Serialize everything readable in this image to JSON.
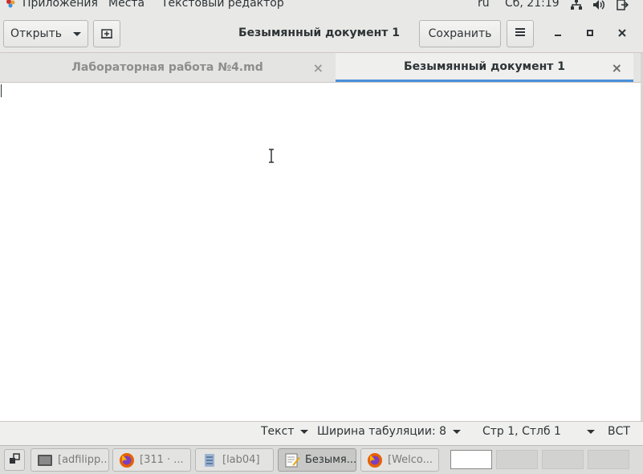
{
  "topbar": {
    "applications": "Приложения",
    "places": "Места",
    "app_name": "Текстовый редактор",
    "lang": "ru",
    "clock": "Сб, 21:19",
    "icons": [
      "network-icon",
      "volume-icon",
      "power-icon"
    ]
  },
  "header": {
    "open_label": "Открыть",
    "title": "Безымянный документ 1",
    "save_label": "Сохранить",
    "icons": [
      "new-document-icon",
      "hamburger-menu-icon",
      "minimize-icon",
      "maximize-icon",
      "close-icon"
    ]
  },
  "tabs": [
    {
      "label": "Лабораторная работа №4.md",
      "close": "×",
      "active": false
    },
    {
      "label": "Безымянный документ 1",
      "close": "×",
      "active": true
    }
  ],
  "editor": {
    "content": ""
  },
  "statusbar": {
    "syntax": "Текст",
    "tab_width": "Ширина табуляции: 8",
    "position": "Стр 1, Стлб 1",
    "mode": "ВСТ"
  },
  "taskbar": {
    "items": [
      {
        "label": "[adfilipp...",
        "icon": "terminal-icon",
        "active": false
      },
      {
        "label": "[311 · ...",
        "icon": "firefox-icon",
        "active": false
      },
      {
        "label": "[lab04]",
        "icon": "file-manager-icon",
        "active": false
      },
      {
        "label": "Безымя...",
        "icon": "text-editor-icon",
        "active": true
      },
      {
        "label": "[Welco...",
        "icon": "firefox-icon",
        "active": false
      }
    ],
    "workspaces": 4,
    "current_workspace": 1
  },
  "colors": {
    "accent": "#4a90d9",
    "tab_active_text": "#2e3436",
    "tab_inactive_text": "#8d8d8b"
  }
}
